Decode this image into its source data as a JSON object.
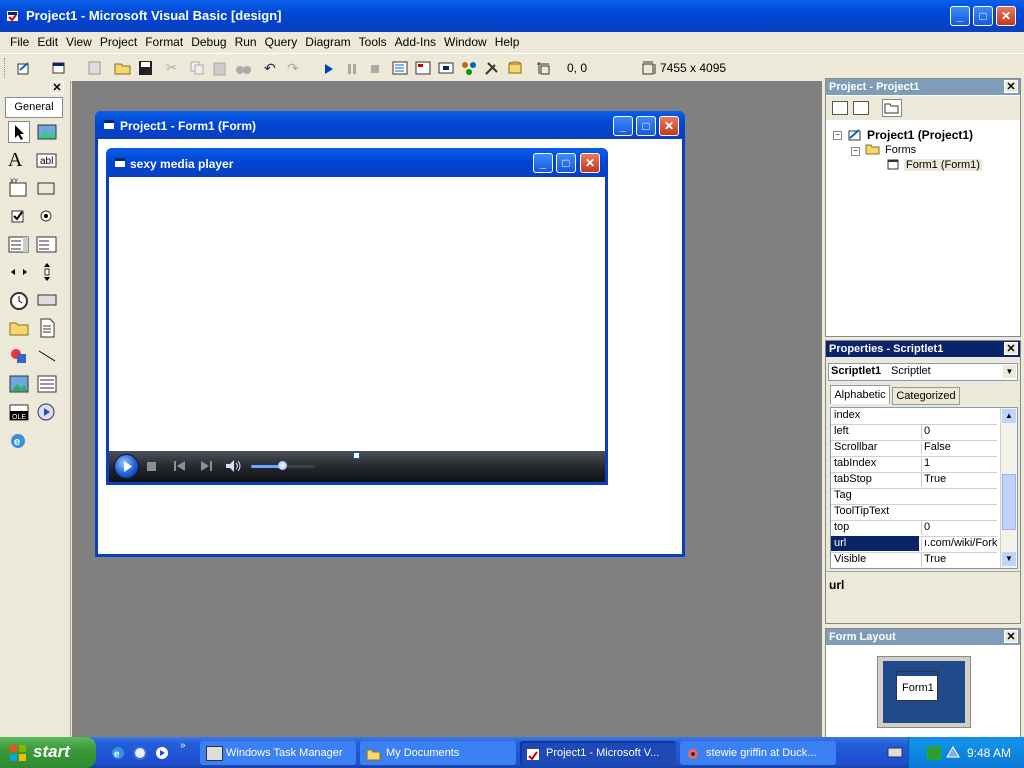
{
  "window": {
    "title": "Project1 - Microsoft Visual Basic [design]"
  },
  "menu": [
    "File",
    "Edit",
    "View",
    "Project",
    "Format",
    "Debug",
    "Run",
    "Query",
    "Diagram",
    "Tools",
    "Add-Ins",
    "Window",
    "Help"
  ],
  "toolbar": {
    "position": "0, 0",
    "size": "7455 x 4095"
  },
  "toolbox": {
    "tab": "General"
  },
  "form_designer": {
    "title": "Project1 - Form1 (Form)"
  },
  "inner_form": {
    "title": "sexy media player"
  },
  "project_panel": {
    "title": "Project - Project1",
    "root": "Project1 (Project1)",
    "folder": "Forms",
    "item": "Form1 (Form1)"
  },
  "properties_panel": {
    "title": "Properties - Scriptlet1",
    "object_name": "Scriptlet1",
    "object_type": "Scriptlet",
    "tabs": [
      "Alphabetic",
      "Categorized"
    ],
    "rows": [
      {
        "k": "index",
        "v": ""
      },
      {
        "k": "left",
        "v": "0"
      },
      {
        "k": "Scrollbar",
        "v": "False"
      },
      {
        "k": "tabIndex",
        "v": "1"
      },
      {
        "k": "tabStop",
        "v": "True"
      },
      {
        "k": "Tag",
        "v": ""
      },
      {
        "k": "ToolTipText",
        "v": ""
      },
      {
        "k": "top",
        "v": "0"
      },
      {
        "k": "url",
        "v": "ı.com/wiki/Fork"
      },
      {
        "k": "Visible",
        "v": "True"
      }
    ],
    "description_label": "url"
  },
  "form_layout": {
    "title": "Form Layout",
    "thumb_label": "Form1"
  },
  "taskbar": {
    "start": "start",
    "items": [
      "Windows Task Manager",
      "My Documents",
      "Project1 - Microsoft V...",
      "stewie griffin at Duck..."
    ],
    "clock": "9:48 AM"
  },
  "colors": {
    "xp_blue": "#0046d5",
    "mdi_gray": "#808080",
    "selected": "#0a246a"
  }
}
